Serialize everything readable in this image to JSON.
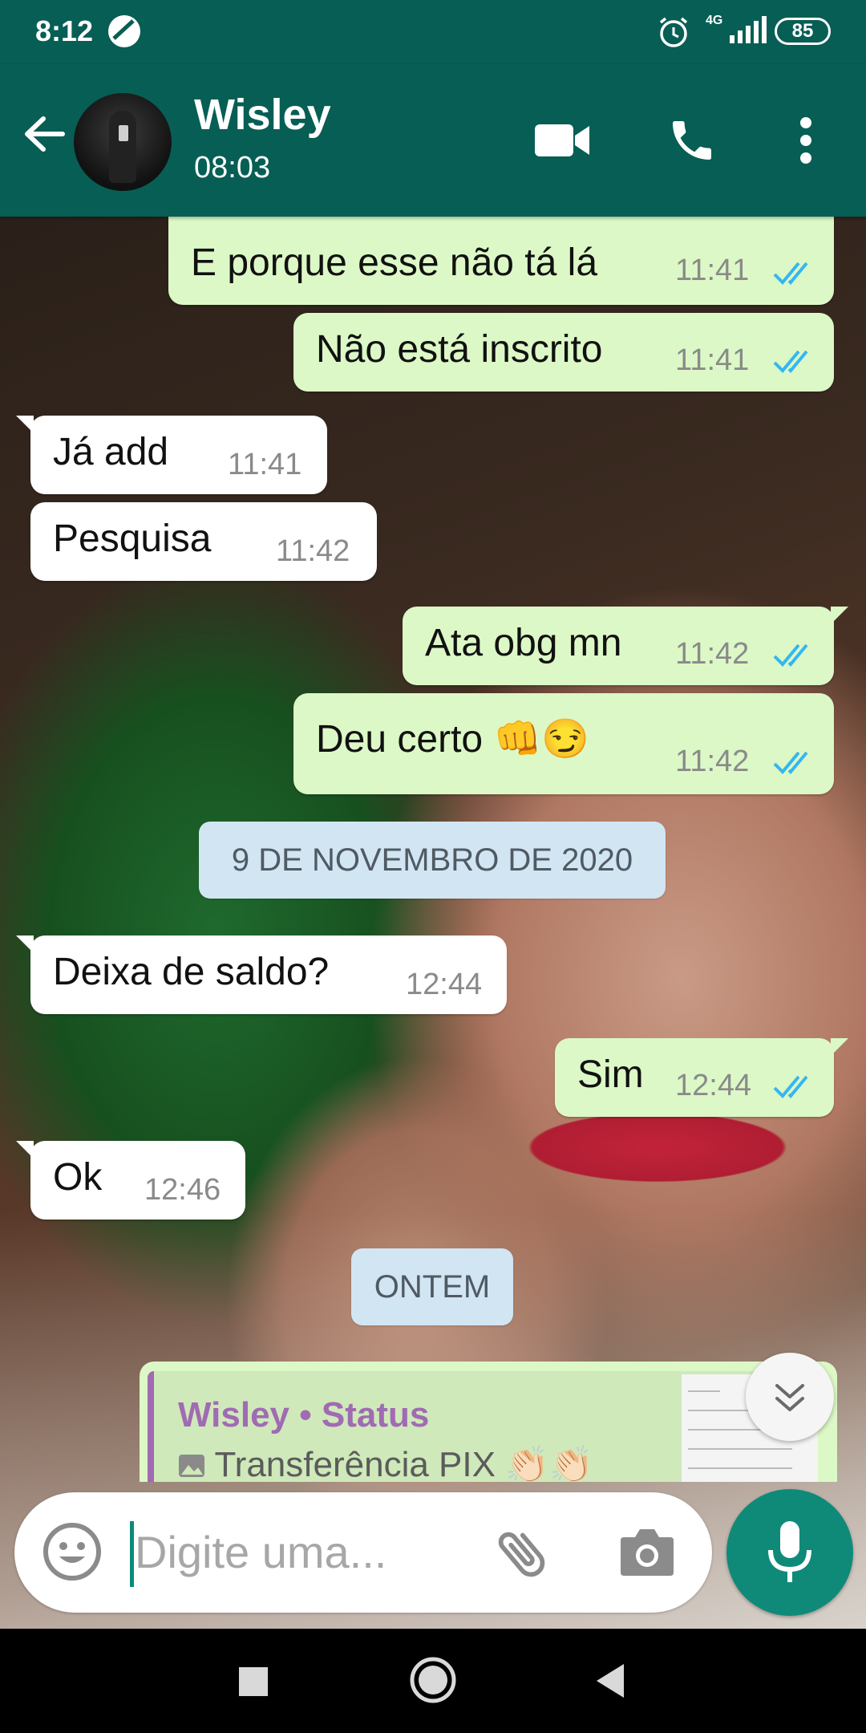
{
  "status_bar": {
    "time": "8:12",
    "network": "4G",
    "battery": "85"
  },
  "header": {
    "contact_name": "Wisley",
    "last_seen": "08:03"
  },
  "messages": [
    {
      "dir": "out",
      "text": "E porque esse não tá lá",
      "time": "11:41",
      "read": true
    },
    {
      "dir": "out",
      "text": "Não está inscrito",
      "time": "11:41",
      "read": true
    },
    {
      "dir": "in",
      "text": "Já add",
      "time": "11:41"
    },
    {
      "dir": "in",
      "text": "Pesquisa",
      "time": "11:42"
    },
    {
      "dir": "out",
      "text": "Ata obg mn",
      "time": "11:42",
      "read": true
    },
    {
      "dir": "out",
      "text": "Deu certo 👊😏",
      "time": "11:42",
      "read": true
    },
    {
      "dir": "date",
      "text": "9 DE NOVEMBRO DE 2020"
    },
    {
      "dir": "in",
      "text": "Deixa de saldo?",
      "time": "12:44"
    },
    {
      "dir": "out",
      "text": "Sim",
      "time": "12:44",
      "read": true
    },
    {
      "dir": "in",
      "text": "Ok",
      "time": "12:46"
    },
    {
      "dir": "date",
      "text": "ONTEM"
    }
  ],
  "quoted_reply": {
    "author": "Wisley • Status",
    "text": "Transferência PIX 👏🏻👏🏻"
  },
  "composer": {
    "placeholder": "Digite uma..."
  },
  "colors": {
    "header": "#075e54",
    "outgoing": "#dcf8c6",
    "incoming": "#ffffff",
    "read_ticks": "#34b7f1",
    "fab": "#0f8a79"
  },
  "icons": [
    "back-arrow-icon",
    "video-call-icon",
    "voice-call-icon",
    "more-menu-icon",
    "emoji-icon",
    "attach-icon",
    "camera-icon",
    "mic-icon",
    "scroll-down-icon"
  ]
}
